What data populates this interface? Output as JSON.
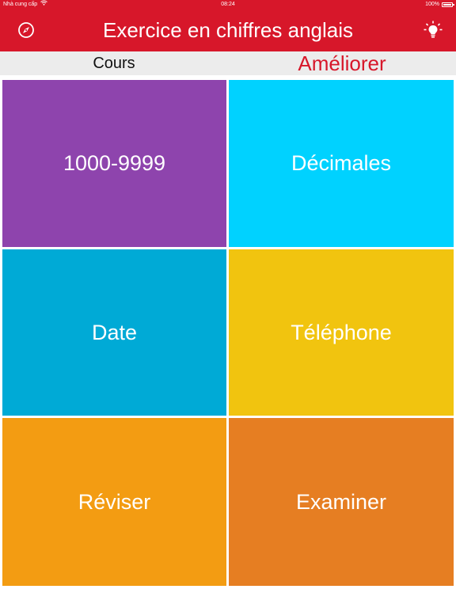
{
  "status_bar": {
    "carrier": "Nhà cung cấp",
    "time": "08:24",
    "battery_label": "100%",
    "battery_level": 1.0,
    "wifi_icon": "wifi-icon"
  },
  "nav": {
    "title": "Exercice en chiffres anglais",
    "left_icon": "compass-icon",
    "right_icon": "lightbulb-icon"
  },
  "segments": {
    "left_label": "Cours",
    "right_label": "Améliorer"
  },
  "tiles": [
    {
      "label": "1000-9999",
      "color": "#8e44ad"
    },
    {
      "label": "Décimales",
      "color": "#00d2ff"
    },
    {
      "label": "Date",
      "color": "#00aad6"
    },
    {
      "label": "Téléphone",
      "color": "#f1c40f"
    },
    {
      "label": "Réviser",
      "color": "#f39c12"
    },
    {
      "label": "Examiner",
      "color": "#e67e22"
    }
  ],
  "colors": {
    "brand": "#d7172a",
    "segment_bg": "#ececec"
  }
}
